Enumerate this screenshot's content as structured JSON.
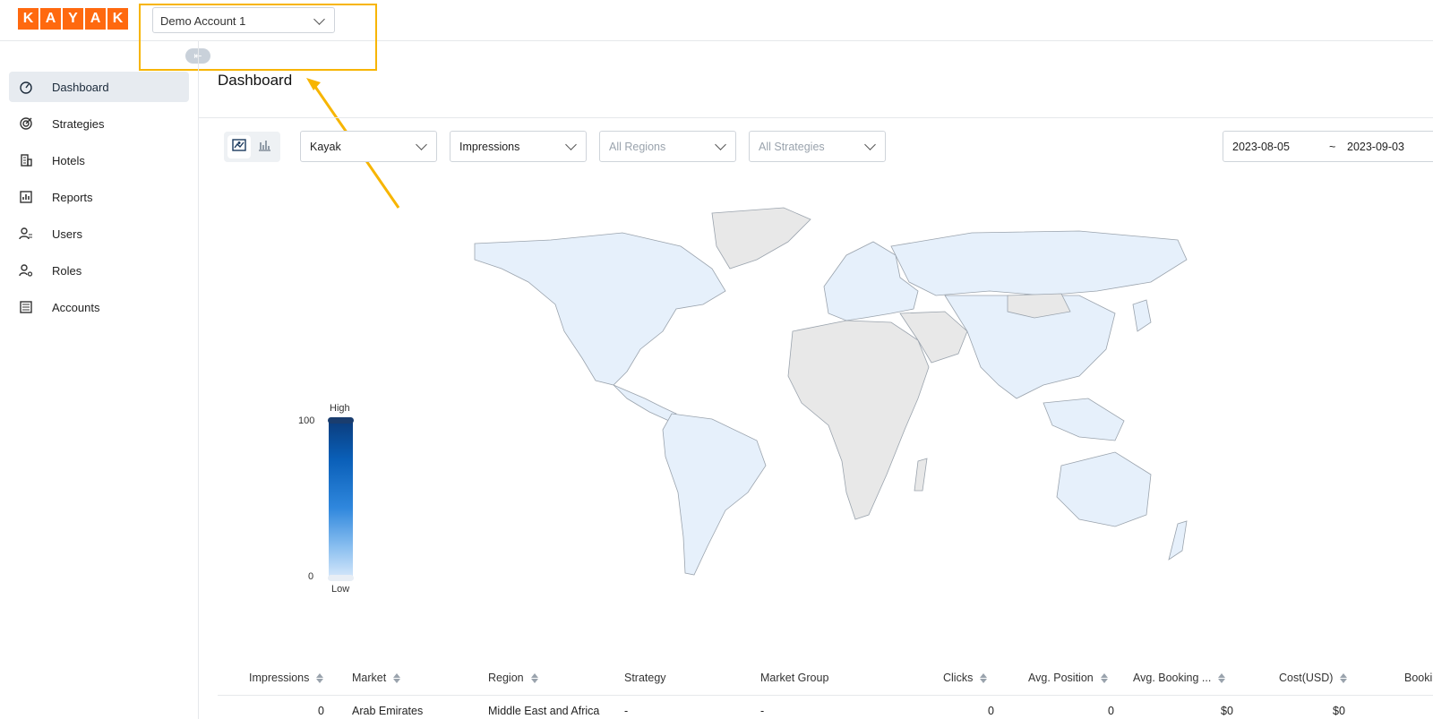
{
  "header": {
    "logo_letters": [
      "K",
      "A",
      "Y",
      "A",
      "K"
    ],
    "account_select": "Demo Account 1",
    "collapse_glyph": "⇤"
  },
  "sidebar": {
    "items": [
      {
        "label": "Dashboard",
        "icon": "dashboard-gauge-icon",
        "active": true
      },
      {
        "label": "Strategies",
        "icon": "target-icon",
        "active": false
      },
      {
        "label": "Hotels",
        "icon": "building-icon",
        "active": false
      },
      {
        "label": "Reports",
        "icon": "bar-chart-icon",
        "active": false
      },
      {
        "label": "Users",
        "icon": "user-list-icon",
        "active": false
      },
      {
        "label": "Roles",
        "icon": "user-gear-icon",
        "active": false
      },
      {
        "label": "Accounts",
        "icon": "ledger-icon",
        "active": false
      }
    ]
  },
  "main": {
    "title": "Dashboard",
    "view_toggle": {
      "map": "map-view-icon",
      "chart": "chart-view-icon",
      "selected": "map"
    },
    "filters": {
      "source": "Kayak",
      "metric": "Impressions",
      "region_placeholder": "All Regions",
      "strategy_placeholder": "All Strategies"
    },
    "date_range": {
      "start": "2023-08-05",
      "separator": "~",
      "end": "2023-09-03"
    }
  },
  "legend": {
    "high": "High",
    "low": "Low",
    "max": "100",
    "min": "0"
  },
  "table": {
    "columns": [
      "Impressions",
      "Market",
      "Region",
      "Strategy",
      "Market Group",
      "Clicks",
      "Avg. Position",
      "Avg. Booking ...",
      "Cost(USD)",
      "Booking"
    ],
    "rows": [
      [
        "0",
        "Arab Emirates",
        "Middle East and Africa",
        "-",
        "-",
        "0",
        "0",
        "$0",
        "$0",
        ""
      ]
    ]
  },
  "colors": {
    "brand": "#ff690f",
    "highlight": "#f7b500",
    "map_active": "#e6f0fb",
    "map_inactive": "#e8e8e8"
  }
}
